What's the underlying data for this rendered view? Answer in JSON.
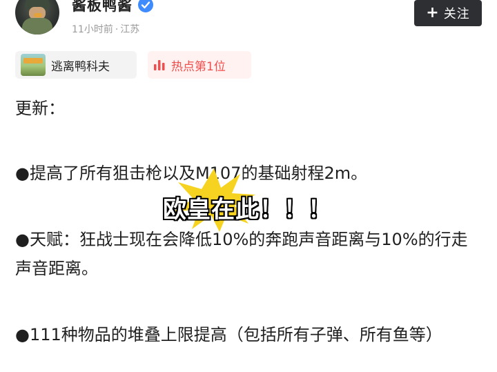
{
  "post": {
    "author_name": "酱板鸭酱",
    "time": "11小时前",
    "separator": "·",
    "location": "江苏",
    "follow_label": "关注",
    "follow_icon": "+"
  },
  "tags": {
    "game": "逃离鸭科夫",
    "hot": "热点第1位"
  },
  "content": {
    "title": "更新：",
    "items": [
      "●提高了所有狙击枪以及M107的基础射程2m。",
      "●天赋：狂战士现在会降低10%的奔跑声音距离与10%的行走声音距离。",
      "●111种物品的堆叠上限提高（包括所有子弹、所有鱼等）"
    ]
  },
  "overlay": {
    "caption": "欧皇在此！！！",
    "burst_color": "#f7d321"
  },
  "colors": {
    "verified_blue": "#3d8bfd",
    "hot_red": "#f04e4e",
    "follow_bg": "#2d2f33"
  }
}
